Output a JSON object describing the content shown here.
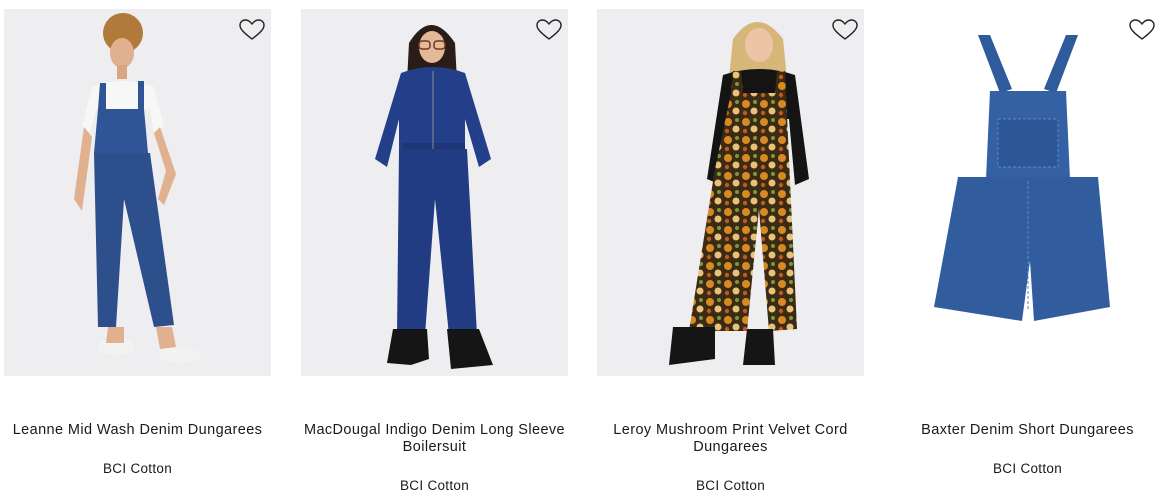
{
  "colors": {
    "image_bg": "#eeedf0",
    "text": "#1a1a1a",
    "denim": "#2e4f8f"
  },
  "products": [
    {
      "title": "Leanne Mid Wash Denim Dungarees",
      "badge": "BCI Cotton",
      "wishlist_icon": "heart-outline-icon"
    },
    {
      "title": "MacDougal Indigo Denim Long Sleeve Boilersuit",
      "badge": "BCI Cotton",
      "wishlist_icon": "heart-outline-icon"
    },
    {
      "title": "Leroy Mushroom Print Velvet Cord Dungarees",
      "badge": "BCI Cotton",
      "wishlist_icon": "heart-outline-icon"
    },
    {
      "title": "Baxter Denim Short Dungarees",
      "badge": "BCI Cotton",
      "wishlist_icon": "heart-outline-icon"
    }
  ]
}
